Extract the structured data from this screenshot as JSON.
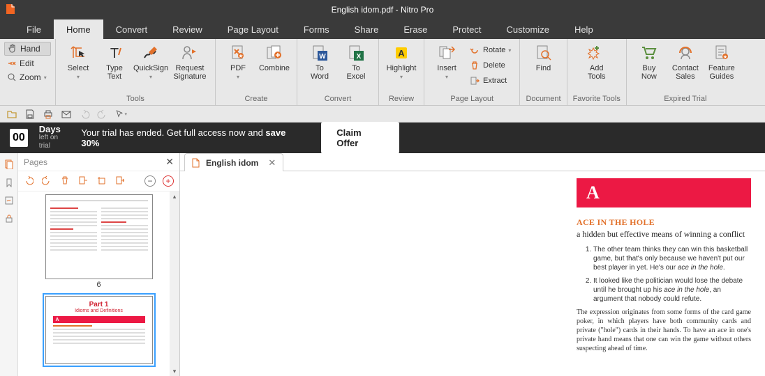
{
  "titlebar": {
    "title": "English idom.pdf - Nitro Pro"
  },
  "menubar": {
    "items": [
      "File",
      "Home",
      "Convert",
      "Review",
      "Page Layout",
      "Forms",
      "Share",
      "Erase",
      "Protect",
      "Customize",
      "Help"
    ],
    "active": 1
  },
  "leftcol": {
    "hand": "Hand",
    "edit": "Edit",
    "zoom": "Zoom"
  },
  "ribbon": {
    "tools": {
      "label": "Tools",
      "select": "Select",
      "typetext": "Type\nText",
      "quicksign": "QuickSign",
      "reqsig": "Request\nSignature"
    },
    "create": {
      "label": "Create",
      "pdf": "PDF",
      "combine": "Combine"
    },
    "convert": {
      "label": "Convert",
      "toword": "To\nWord",
      "toexcel": "To\nExcel"
    },
    "review": {
      "label": "Review",
      "highlight": "Highlight"
    },
    "pagelayout": {
      "label": "Page Layout",
      "insert": "Insert",
      "rotate": "Rotate",
      "delete": "Delete",
      "extract": "Extract"
    },
    "document": {
      "label": "Document",
      "find": "Find"
    },
    "favtools": {
      "label": "Favorite Tools",
      "addtools": "Add\nTools"
    },
    "expired": {
      "label": "Expired Trial",
      "buynow": "Buy\nNow",
      "contact": "Contact\nSales",
      "guides": "Feature\nGuides"
    }
  },
  "trial": {
    "count": "00",
    "days": "Days",
    "left": "left on trial",
    "msg": "Your trial has ended. Get full access now and ",
    "save": "save 30%",
    "claim": "Claim Offer"
  },
  "pagespanel": {
    "title": "Pages"
  },
  "thumbs": {
    "num1": "6",
    "t2title": "Part 1",
    "t2sub": "Idioms and Definitions",
    "t2bar": "A"
  },
  "doctab": {
    "name": "English idom"
  },
  "doc": {
    "bigletter": "A",
    "idiom": "ACE IN THE HOLE",
    "def": "a hidden but effective means of winning a conflict",
    "ex1a": "The other team thinks they can win this basketball game, but that's only because we haven't put our best player in yet. He's our ",
    "ex1b": "ace in the hole",
    "ex1c": ".",
    "ex2a": "It looked like the politician would lose the debate until he brought up his ",
    "ex2b": "ace in the hole",
    "ex2c": ", an argument that nobody could refute.",
    "expl": "The expression originates from some forms of the card game poker, in which players have both community cards and private (\"hole\") cards in their hands. To have an ace in one's private hand means that one can win the game without others suspecting ahead of time."
  }
}
